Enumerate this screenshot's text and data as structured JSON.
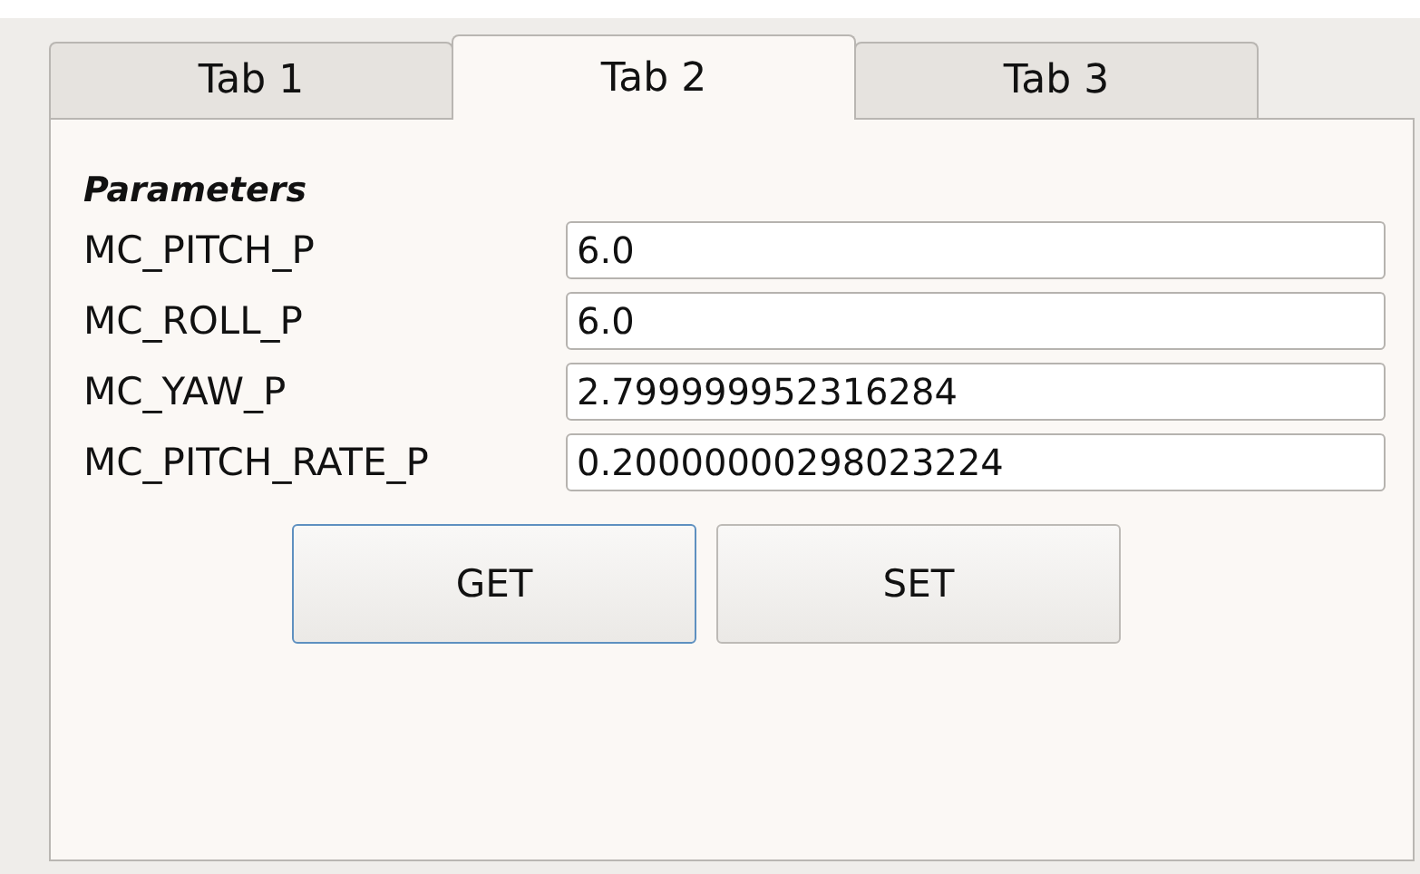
{
  "tabs": [
    {
      "label": "Tab 1",
      "selected": false
    },
    {
      "label": "Tab 2",
      "selected": true
    },
    {
      "label": "Tab 3",
      "selected": false
    }
  ],
  "section_title": "Parameters",
  "parameters": [
    {
      "name": "MC_PITCH_P",
      "value": "6.0"
    },
    {
      "name": "MC_ROLL_P",
      "value": "6.0"
    },
    {
      "name": "MC_YAW_P",
      "value": "2.799999952316284"
    },
    {
      "name": "MC_PITCH_RATE_P",
      "value": "0.20000000298023224"
    }
  ],
  "buttons": [
    {
      "label": "GET",
      "focused": true
    },
    {
      "label": "SET",
      "focused": false
    }
  ]
}
